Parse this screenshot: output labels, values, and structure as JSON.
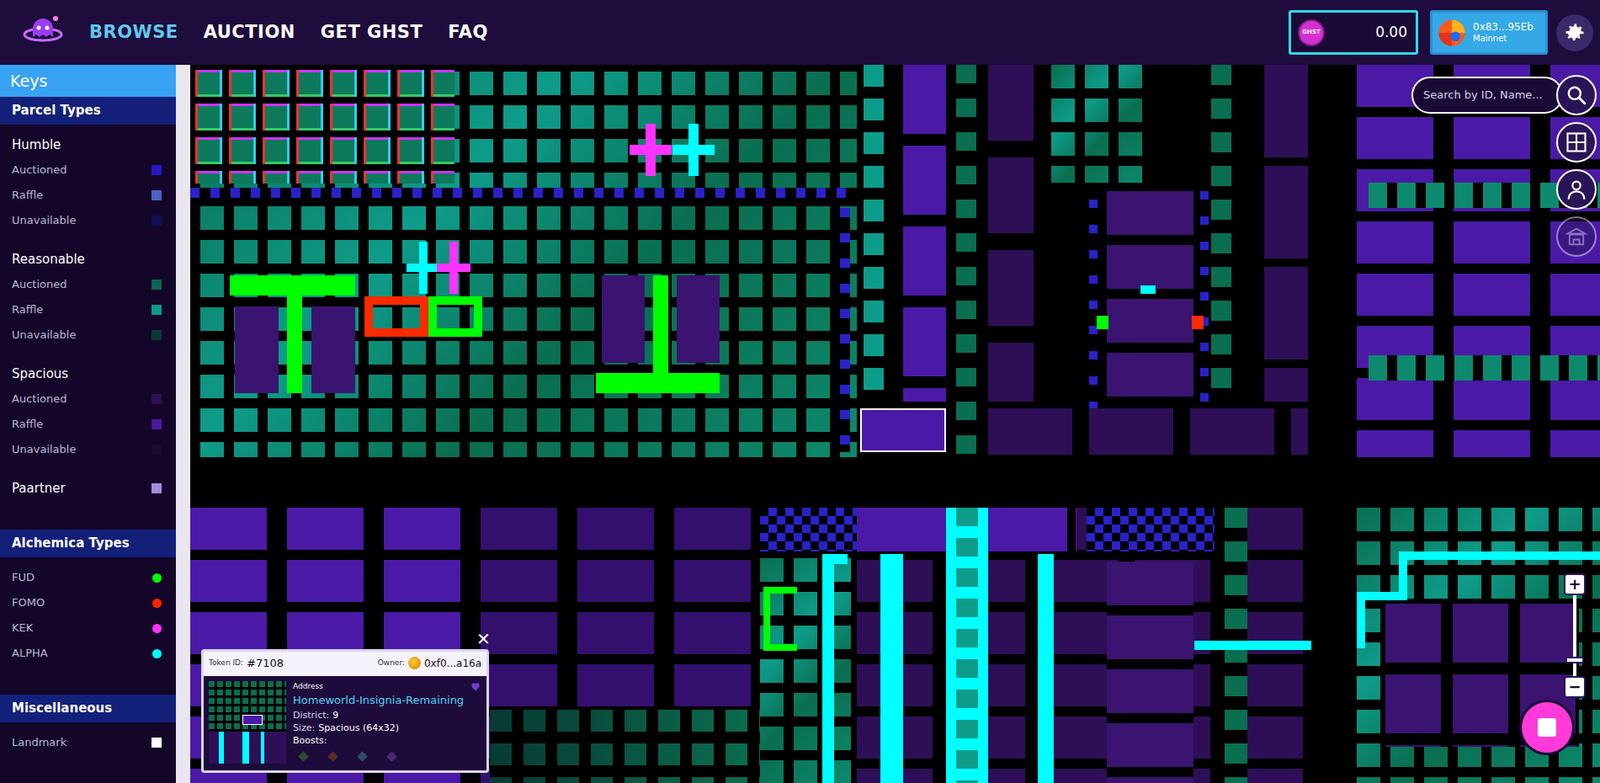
{
  "nav": {
    "items": [
      {
        "label": "BROWSE",
        "selected": true
      },
      {
        "label": "AUCTION",
        "selected": false
      },
      {
        "label": "GET GHST",
        "selected": false
      },
      {
        "label": "FAQ",
        "selected": false
      }
    ]
  },
  "balance": {
    "token": "GHST",
    "amount": "0.00"
  },
  "wallet": {
    "address": "0x83...95Eb",
    "network": "Mainnet"
  },
  "search": {
    "placeholder": "Search by ID, Name..."
  },
  "tools": [
    {
      "disabled": false
    },
    {
      "disabled": false
    },
    {
      "disabled": true
    }
  ],
  "sidebar": {
    "title": "Keys",
    "sections": [
      {
        "title": "Parcel Types",
        "entries": [
          {
            "kind": "heading",
            "label": "Humble"
          },
          {
            "kind": "key",
            "label": "Auctioned",
            "color": "#2718c6"
          },
          {
            "kind": "key",
            "label": "Raffle",
            "color": "#4a63c4"
          },
          {
            "kind": "key",
            "label": "Unavailable",
            "color": "#0e1150"
          },
          {
            "kind": "heading",
            "label": "Reasonable"
          },
          {
            "kind": "key",
            "label": "Auctioned",
            "color": "#0a6650"
          },
          {
            "kind": "key",
            "label": "Raffle",
            "color": "#0d9b8b"
          },
          {
            "kind": "key",
            "label": "Unavailable",
            "color": "#073a33"
          },
          {
            "kind": "heading",
            "label": "Spacious"
          },
          {
            "kind": "key",
            "label": "Auctioned",
            "color": "#2d1050"
          },
          {
            "kind": "key",
            "label": "Raffle",
            "color": "#4b1aa0"
          },
          {
            "kind": "key",
            "label": "Unavailable",
            "color": "#1c0a33"
          },
          {
            "kind": "key-large",
            "label": "Paartner",
            "color": "#a48ae0"
          }
        ]
      },
      {
        "title": "Alchemica Types",
        "entries": [
          {
            "kind": "dot",
            "label": "FUD",
            "color": "#00ff00"
          },
          {
            "kind": "dot",
            "label": "FOMO",
            "color": "#ff2200"
          },
          {
            "kind": "dot",
            "label": "KEK",
            "color": "#ff33ff"
          },
          {
            "kind": "dot",
            "label": "ALPHA",
            "color": "#00ffff"
          }
        ]
      },
      {
        "title": "Miscellaneous",
        "entries": [
          {
            "kind": "key",
            "label": "Landmark",
            "color": "#ffffff"
          }
        ]
      }
    ]
  },
  "popup": {
    "close": "✕",
    "token_label": "Token ID:",
    "token_id": "#7108",
    "owner_label": "Owner:",
    "owner": "0xf0...a16a",
    "address_label": "Address",
    "address": "Homeworld-Insignia-Remaining",
    "fields": [
      {
        "label": "District:",
        "value": "9"
      },
      {
        "label": "Size:",
        "value": "Spacious (64x32)"
      }
    ],
    "boosts_label": "Boosts:",
    "boosts": [
      {
        "color": "#2e4a33"
      },
      {
        "color": "#5a2a2a"
      },
      {
        "color": "#2e4a66"
      },
      {
        "color": "#4a2a66"
      }
    ]
  },
  "zoom": {
    "in": "+",
    "out": "−",
    "level": 0.2
  }
}
